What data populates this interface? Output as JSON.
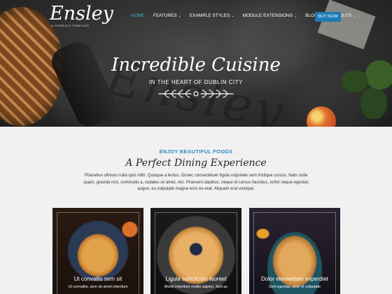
{
  "header": {
    "logo_name": "Ensley",
    "logo_tagline": "A JOOMLA!3 TEMPLATE",
    "nav": [
      {
        "label": "HOME",
        "active": true,
        "has_dropdown": false
      },
      {
        "label": "FEATURES",
        "active": false,
        "has_dropdown": true
      },
      {
        "label": "EXAMPLE STYLES",
        "active": false,
        "has_dropdown": true
      },
      {
        "label": "MODULE EXTENSIONS",
        "active": false,
        "has_dropdown": true
      },
      {
        "label": "BLOG",
        "active": false,
        "has_dropdown": true
      },
      {
        "label": "LAYOUTS",
        "active": false,
        "has_dropdown": true
      }
    ],
    "cta": "BUY NOW",
    "nav_active_color": "#3bb1d6",
    "cta_color": "#1c7ab2"
  },
  "hero": {
    "title": "Incredible Cuisine",
    "subtitle": "IN THE HEART OF DUBLIN CITY",
    "background_script": "Ensley",
    "divider_icon": "laurel-divider-icon"
  },
  "intro": {
    "eyebrow": "ENJOY BEAUTIFUL FOODS",
    "title": "A Perfect Dining Experience",
    "body": "Phasellus ultrices nulla quis nibh. Quisque a lectus. Donec consectetuer ligula vulputate sem tristique cursus. Nam nulla quam, gravida non, commodo a, sodales sit amet, nisi. Praesent dapibus, neque id cursus faucibus, tortor neque egestas augue, eu vulputate magna eros eu erat. Aliquam erat volutpat.",
    "accent_color": "#2a8bbf"
  },
  "cards": [
    {
      "title": "Ut convallis sem sit",
      "desc": "Ut convallis, sem sit amet interdum"
    },
    {
      "title": "Ligula sollicitudin laoreet",
      "desc": "Morbi interdum mollis sapien. Sed ac"
    },
    {
      "title": "Dolor elementum imperdiet",
      "desc": "Sed egestas, ante et vulputate"
    }
  ]
}
